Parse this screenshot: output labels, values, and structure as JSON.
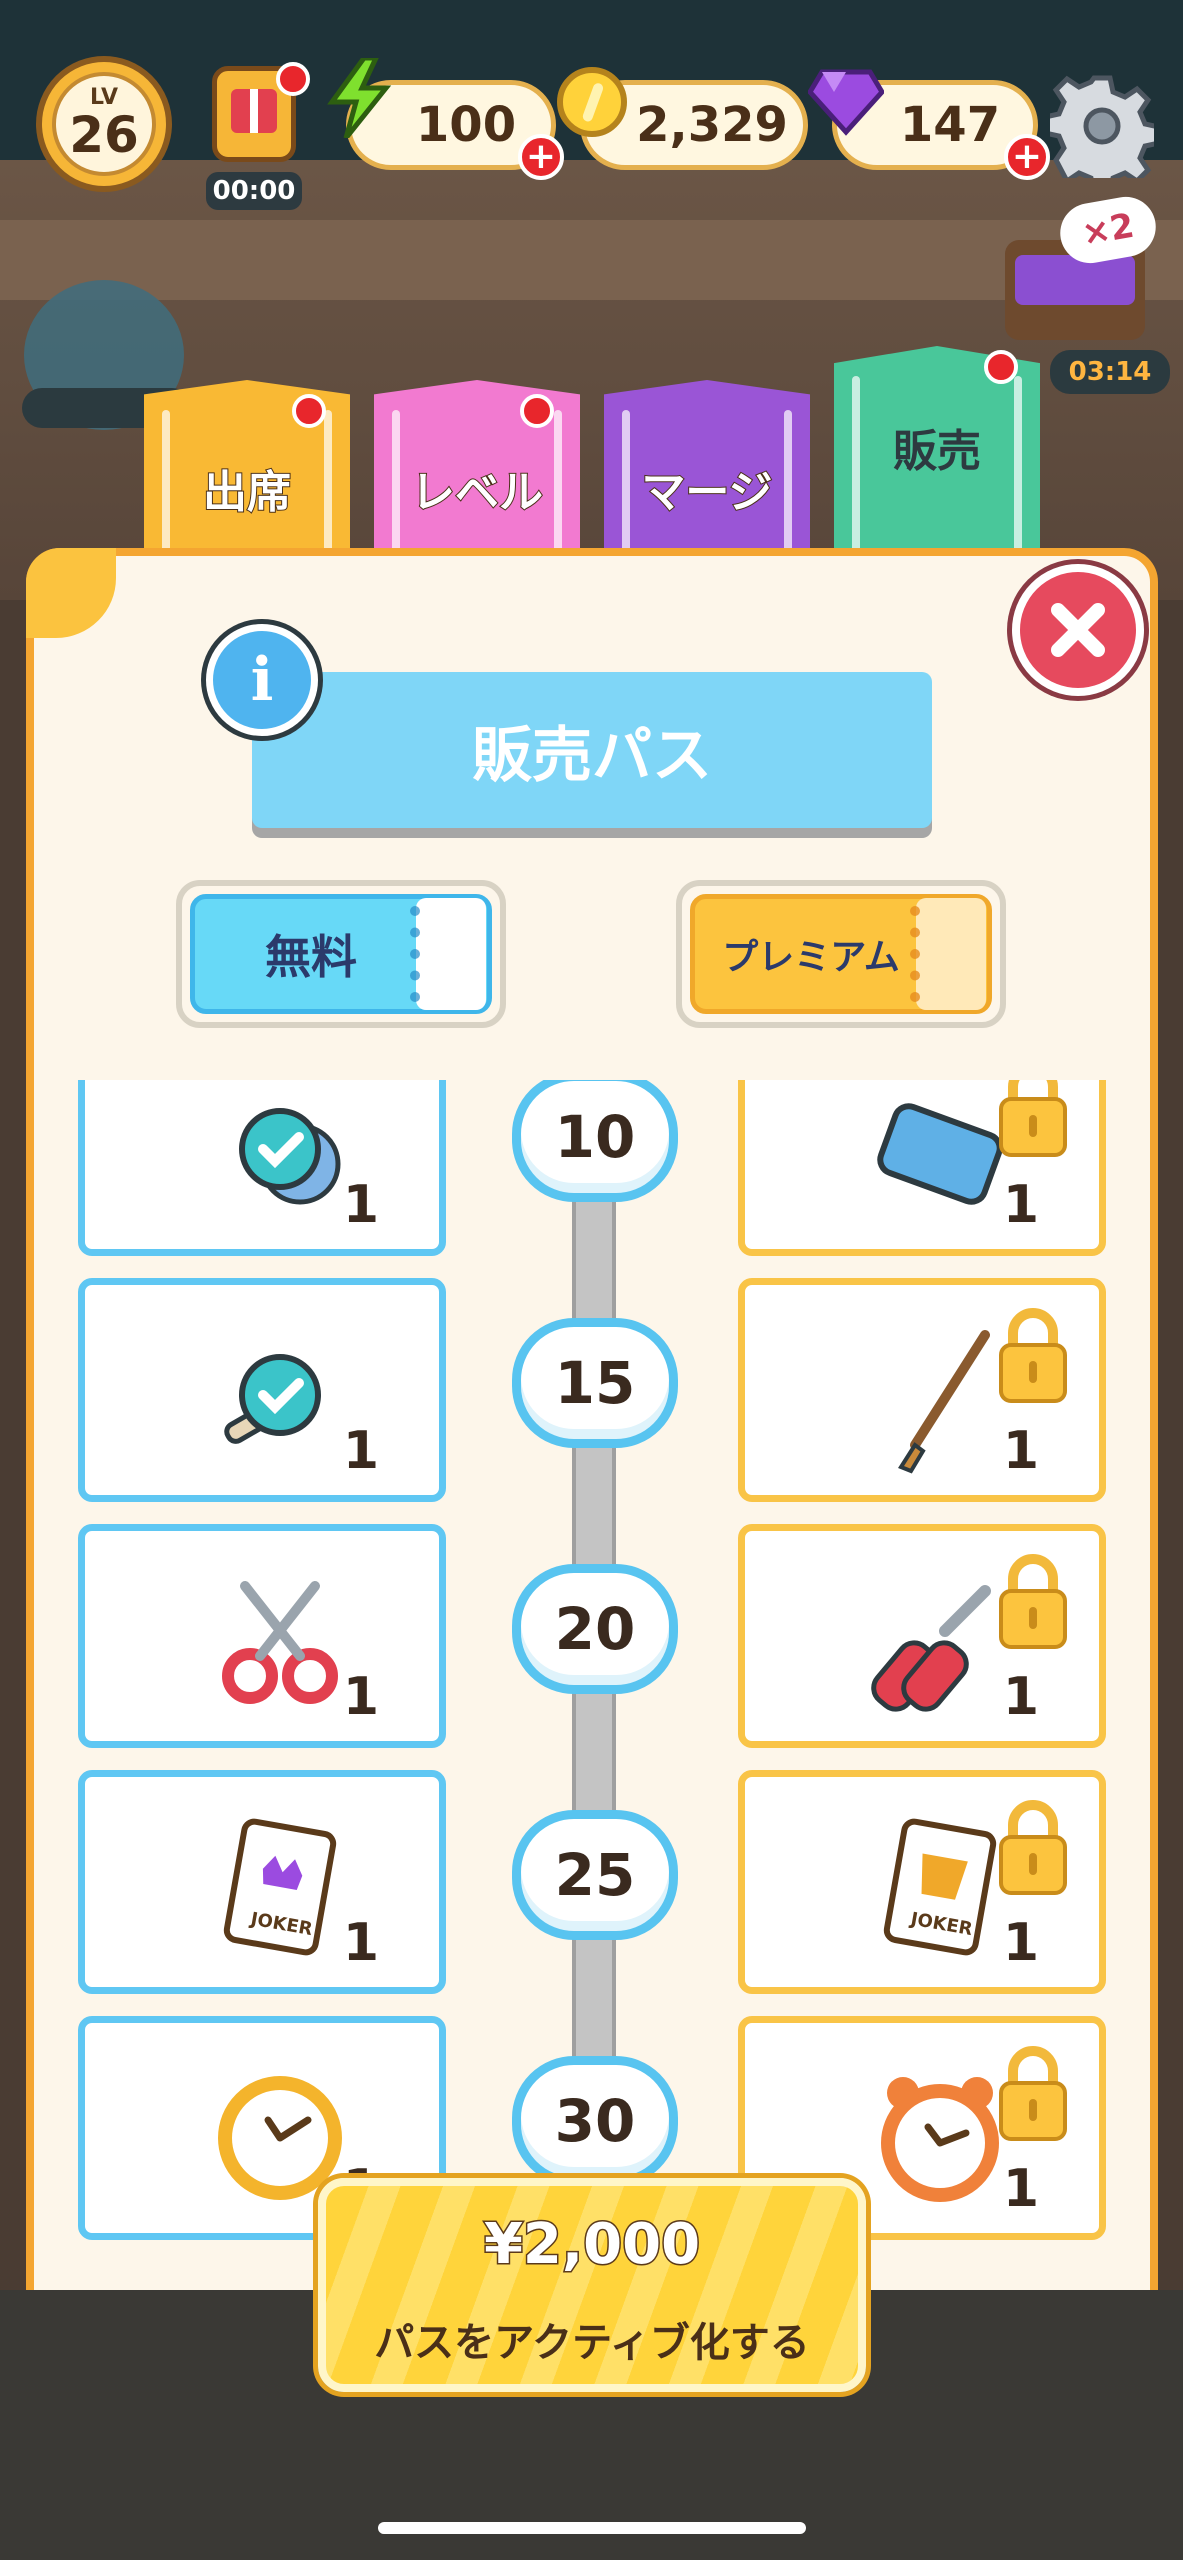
{
  "topbar": {
    "level_label": "LV",
    "level": "26",
    "gift_timer": "00:00",
    "energy": "100",
    "coins": "2,329",
    "gems": "147",
    "icons": [
      "gift-icon",
      "lightning-icon",
      "coin-icon",
      "gem-icon",
      "gear-icon"
    ]
  },
  "background": {
    "chest_timer": "03:14"
  },
  "tabs": [
    {
      "label": "出席",
      "color": "#f9b934"
    },
    {
      "label": "レベル",
      "color": "#f27ad0"
    },
    {
      "label": "マージ",
      "color": "#9a55d6"
    },
    {
      "label": "販売",
      "color": "#49c79a"
    }
  ],
  "panel": {
    "title": "販売パス",
    "info_icon": "i",
    "free_label": "無料",
    "premium_label": "プレミアム"
  },
  "rewards": [
    {
      "level": "10",
      "free_item": "confirm-token-icon",
      "free_qty": "1",
      "premium_item": "speaker-icon",
      "premium_qty": "1",
      "premium_locked": true
    },
    {
      "level": "15",
      "free_item": "confirm-brush-icon",
      "free_qty": "1",
      "premium_item": "brush-icon",
      "premium_qty": "1",
      "premium_locked": true
    },
    {
      "level": "20",
      "free_item": "scissors-icon",
      "free_qty": "1",
      "premium_item": "pruner-icon",
      "premium_qty": "1",
      "premium_locked": true
    },
    {
      "level": "25",
      "free_item": "joker-card-icon",
      "free_qty": "1",
      "free_card_text": "JOKER",
      "premium_item": "joker-card-premium-icon",
      "premium_qty": "1",
      "premium_card_text": "JOKER",
      "premium_locked": true
    },
    {
      "level": "30",
      "free_item": "clock-icon",
      "free_qty": "1",
      "premium_item": "alarm-clock-icon",
      "premium_qty": "1",
      "premium_locked": true
    }
  ],
  "purchase": {
    "price": "¥2,000",
    "label": "パスをアクティブ化する"
  }
}
